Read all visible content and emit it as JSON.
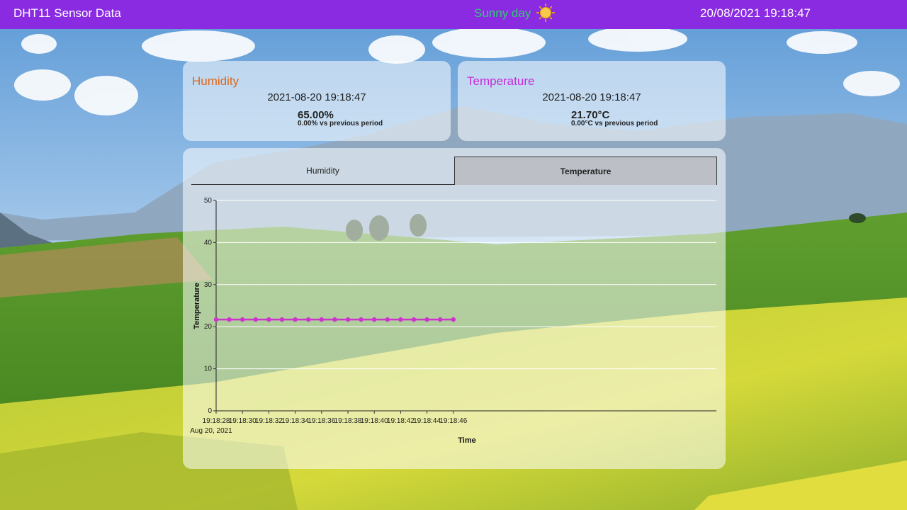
{
  "header": {
    "app_title": "DHT11 Sensor Data",
    "weather_label": "Sunny day",
    "datetime": "20/08/2021 19:18:47"
  },
  "cards": {
    "humidity": {
      "title": "Humidity",
      "timestamp": "2021-08-20 19:18:47",
      "value": "65.00%",
      "delta": "0.00% vs previous period",
      "title_color": "#e0661b"
    },
    "temperature": {
      "title": "Temperature",
      "timestamp": "2021-08-20 19:18:47",
      "value": "21.70°C",
      "delta": "0.00°C vs previous period",
      "title_color": "#c62bd8"
    }
  },
  "tabs": {
    "humidity_label": "Humidity",
    "temperature_label": "Temperature",
    "selected": "Temperature"
  },
  "colors": {
    "header_bg": "#8a2be2",
    "weather_text": "#2ecc71",
    "series_line": "#cc33cc"
  },
  "chart_data": {
    "type": "line",
    "xlabel": "Time",
    "ylabel": "Temperature",
    "ylim": [
      0,
      50
    ],
    "yticks": [
      0,
      10,
      20,
      30,
      40,
      50
    ],
    "grid": "horizontal",
    "x_tick_labels": [
      "19:18:28",
      "19:18:30",
      "19:18:32",
      "19:18:34",
      "19:18:36",
      "19:18:38",
      "19:18:40",
      "19:18:42",
      "19:18:44",
      "19:18:46"
    ],
    "x_tick_sublabel": "Aug 20, 2021",
    "x": [
      "19:18:28",
      "19:18:29",
      "19:18:30",
      "19:18:31",
      "19:18:32",
      "19:18:33",
      "19:18:34",
      "19:18:35",
      "19:18:36",
      "19:18:37",
      "19:18:38",
      "19:18:39",
      "19:18:40",
      "19:18:41",
      "19:18:42",
      "19:18:43",
      "19:18:44",
      "19:18:45",
      "19:18:46"
    ],
    "series": [
      {
        "values": [
          21.7,
          21.7,
          21.7,
          21.7,
          21.7,
          21.7,
          21.7,
          21.7,
          21.7,
          21.7,
          21.7,
          21.7,
          21.7,
          21.7,
          21.7,
          21.7,
          21.7,
          21.7,
          21.7
        ]
      }
    ]
  }
}
